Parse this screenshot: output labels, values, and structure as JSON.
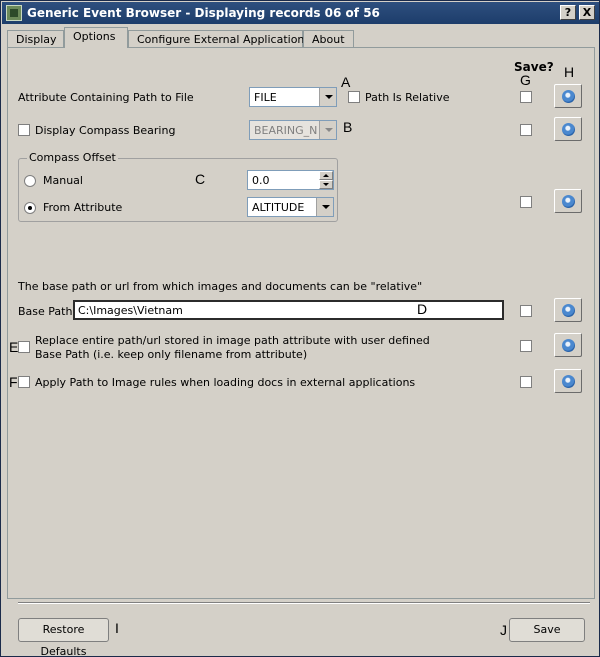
{
  "window": {
    "title": "Generic Event Browser - Displaying records 06 of 56",
    "help_label": "?",
    "close_label": "X"
  },
  "tabs": [
    {
      "label": "Display",
      "active": false
    },
    {
      "label": "Options",
      "active": true
    },
    {
      "label": "Configure External Applications",
      "active": false
    },
    {
      "label": "About",
      "active": false
    }
  ],
  "annotations": {
    "a": "A",
    "b": "B",
    "c": "C",
    "d": "D",
    "e": "E",
    "f": "F",
    "g": "G",
    "h": "H",
    "i": "I",
    "j": "J"
  },
  "options": {
    "save_header": "Save?",
    "attribute_path": {
      "label": "Attribute Containing Path to File",
      "value": "FILE",
      "relative_label": "Path Is Relative",
      "relative_checked": false
    },
    "compass_bearing": {
      "label": "Display Compass Bearing",
      "checked": false,
      "value": "BEARING_N"
    },
    "compass_offset": {
      "title": "Compass Offset",
      "manual_label": "Manual",
      "manual_value": "0.0",
      "from_attribute_label": "From Attribute",
      "attribute_value": "ALTITUDE",
      "selected": "From Attribute"
    },
    "base_path_desc": "The base path or url from which images and documents can be \"relative\"",
    "base_path_label": "Base Path",
    "base_path_value": "C:\\Images\\Vietnam",
    "replace_path": {
      "label_line1": "Replace entire path/url stored in image path attribute with user defined",
      "label_line2": "Base Path (i.e. keep only filename from attribute)",
      "checked": false
    },
    "apply_rules": {
      "label": "Apply Path to Image rules when loading docs in external applications",
      "checked": false
    }
  },
  "buttons": {
    "restore_defaults": "Restore Defaults",
    "save": "Save"
  }
}
